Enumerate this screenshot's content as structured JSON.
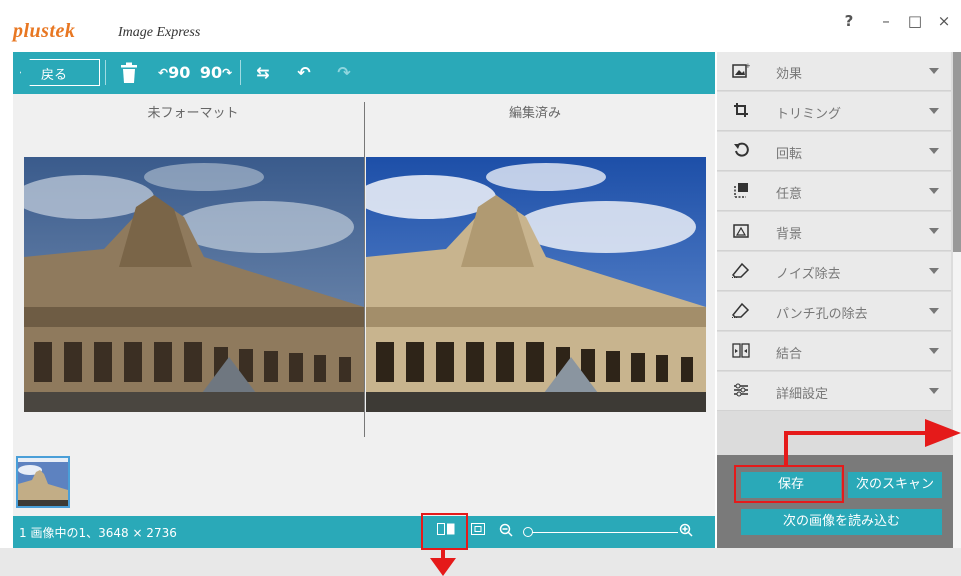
{
  "window": {
    "logo": "plustek",
    "app_name": "Image Express",
    "help_label": "?",
    "minimize_label": "–",
    "maximize_label": "□",
    "close_label": "×"
  },
  "toolbar": {
    "back_label": "戻る",
    "rotate_left_label": "90",
    "rotate_right_label": "90",
    "flip_label": "⇆",
    "undo_label": "↶",
    "redo_label": "↷"
  },
  "preview": {
    "original_label": "未フォーマット",
    "edited_label": "編集済み"
  },
  "status": {
    "info": "1 画像中の1、3648 × 2736"
  },
  "side_menu": {
    "items": [
      {
        "label": "効果",
        "icon": "effect-icon"
      },
      {
        "label": "トリミング",
        "icon": "crop-icon"
      },
      {
        "label": "回転",
        "icon": "rotate-icon"
      },
      {
        "label": "任意",
        "icon": "custom-icon"
      },
      {
        "label": "背景",
        "icon": "background-icon"
      },
      {
        "label": "ノイズ除去",
        "icon": "eraser-icon"
      },
      {
        "label": "パンチ孔の除去",
        "icon": "punch-hole-eraser-icon"
      },
      {
        "label": "結合",
        "icon": "merge-icon"
      },
      {
        "label": "詳細設定",
        "icon": "settings-sliders-icon"
      }
    ]
  },
  "actions": {
    "save_label": "保存",
    "next_scan_label": "次のスキャン",
    "load_next_label": "次の画像を読み込む"
  },
  "colors": {
    "accent": "#2aa9b8",
    "logo": "#e87722",
    "callout": "#e51a1a",
    "panel": "#eaeaea"
  }
}
